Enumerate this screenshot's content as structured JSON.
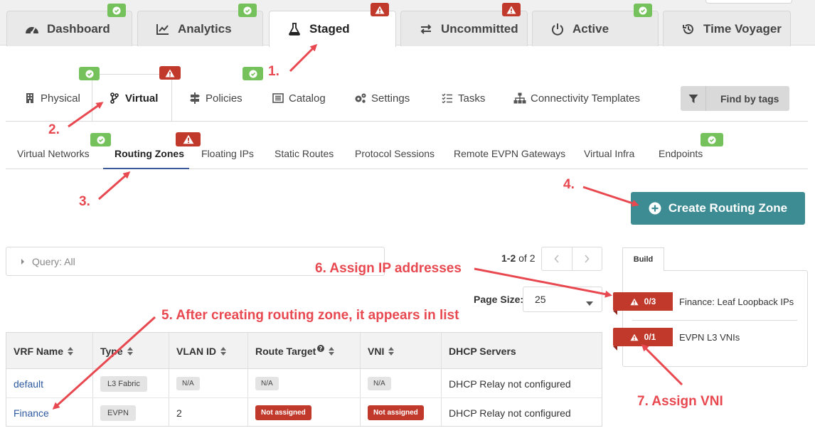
{
  "top_tabs": [
    {
      "label": "Dashboard",
      "icon": "dashboard-icon",
      "status": "ok"
    },
    {
      "label": "Analytics",
      "icon": "chart-icon",
      "status": "ok"
    },
    {
      "label": "Staged",
      "icon": "flask-icon",
      "status": "warn",
      "active": true
    },
    {
      "label": "Uncommitted",
      "icon": "swap-icon",
      "status": "warn"
    },
    {
      "label": "Active",
      "icon": "power-icon",
      "status": "ok"
    },
    {
      "label": "Time Voyager",
      "icon": "history-icon",
      "status": "none"
    }
  ],
  "second_tabs": [
    {
      "label": "Physical",
      "icon": "building-icon"
    },
    {
      "label": "Virtual",
      "icon": "branch-icon",
      "active": true
    },
    {
      "label": "Policies",
      "icon": "signpost-icon"
    },
    {
      "label": "Catalog",
      "icon": "list-box-icon"
    },
    {
      "label": "Settings",
      "icon": "cogs-icon"
    },
    {
      "label": "Tasks",
      "icon": "tasks-icon"
    },
    {
      "label": "Connectivity Templates",
      "icon": "sitemap-icon"
    }
  ],
  "find_tags_label": "Find by tags",
  "third_tabs": [
    {
      "label": "Virtual Networks"
    },
    {
      "label": "Routing Zones",
      "active": true
    },
    {
      "label": "Floating IPs"
    },
    {
      "label": "Static Routes"
    },
    {
      "label": "Protocol Sessions"
    },
    {
      "label": "Remote EVPN Gateways"
    },
    {
      "label": "Virtual Infra"
    },
    {
      "label": "Endpoints"
    }
  ],
  "create_button_label": "Create Routing Zone",
  "query": {
    "label": "Query: All"
  },
  "pagination": {
    "range": "1-2",
    "of": "of",
    "total": "2"
  },
  "page_size": {
    "label": "Page Size:",
    "value": "25"
  },
  "table": {
    "headers": [
      "VRF Name",
      "Type",
      "VLAN ID",
      "Route Target",
      "VNI",
      "DHCP Servers"
    ],
    "rows": [
      {
        "vrf": "default",
        "type": "L3 Fabric",
        "vlan": "N/A",
        "route_target": "N/A",
        "vni": "N/A",
        "dhcp": "DHCP Relay not configured"
      },
      {
        "vrf": "Finance",
        "type": "EVPN",
        "vlan": "2",
        "route_target": "Not assigned",
        "vni": "Not assigned",
        "dhcp": "DHCP Relay not configured"
      }
    ]
  },
  "build": {
    "tab_label": "Build",
    "items": [
      {
        "count": "0/3",
        "label": "Finance: Leaf Loopback IPs"
      },
      {
        "count": "0/1",
        "label": "EVPN L3 VNIs"
      }
    ]
  },
  "annotations": {
    "a1": "1.",
    "a2": "2.",
    "a3": "3.",
    "a4": "4.",
    "a5": "5. After creating routing zone, it appears in list",
    "a6": "6. Assign IP addresses",
    "a7": "7. Assign VNI"
  },
  "colors": {
    "ok": "#75c25c",
    "warn": "#c0392b",
    "primary": "#3d8c93",
    "annotation": "#e8484f",
    "link": "#2c5aa0"
  }
}
